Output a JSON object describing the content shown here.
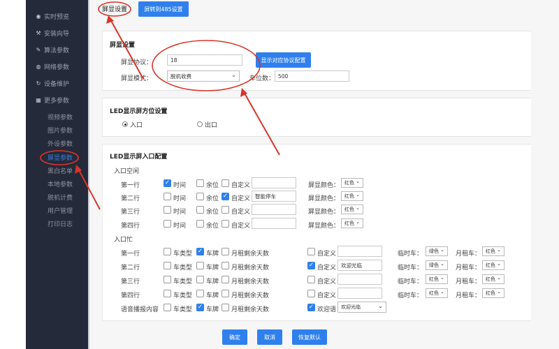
{
  "sidebar": {
    "items": [
      {
        "icon": "eye-icon",
        "glyph": "◉",
        "label": "实时预览"
      },
      {
        "icon": "wrench-icon",
        "glyph": "🔧",
        "label": "安装向导"
      },
      {
        "icon": "pencil-icon",
        "glyph": "✎",
        "label": "算法参数"
      },
      {
        "icon": "globe-icon",
        "glyph": "◍",
        "label": "网络参数"
      },
      {
        "icon": "refresh-icon",
        "glyph": "↻",
        "label": "设备维护"
      },
      {
        "icon": "grid-icon",
        "glyph": "▦",
        "label": "更多参数"
      }
    ],
    "sub_items": [
      {
        "label": "视频参数",
        "active": false
      },
      {
        "label": "图片参数",
        "active": false
      },
      {
        "label": "外设参数",
        "active": false
      },
      {
        "label": "屏显参数",
        "active": true
      },
      {
        "label": "黑白名单",
        "active": false
      },
      {
        "label": "本地参数",
        "active": false
      },
      {
        "label": "脱机计费",
        "active": false
      },
      {
        "label": "用户管理",
        "active": false
      },
      {
        "label": "打印日志",
        "active": false
      }
    ]
  },
  "tabs": {
    "active": "屏显设置",
    "other": "屏转到485设置"
  },
  "screen_settings": {
    "title": "屏显设置",
    "protocol_label": "屏显协议：",
    "protocol_value": "18",
    "show_config_button": "显示对应协议配置",
    "mode_label": "屏显模式：",
    "mode_value": "脱机收费",
    "spaces_label": "车位数：",
    "spaces_value": "500"
  },
  "position_settings": {
    "title": "LED显示屏方位设置",
    "options": [
      {
        "label": "入口",
        "selected": true
      },
      {
        "label": "出口",
        "selected": false
      }
    ]
  },
  "entry_config": {
    "title": "LED显示屏入口配置",
    "idle": {
      "label": "入口空闲",
      "rows": [
        {
          "label": "第一行",
          "time": true,
          "remaining": false,
          "custom": false,
          "custom_text": "",
          "color": "红色"
        },
        {
          "label": "第二行",
          "time": false,
          "remaining": false,
          "custom": true,
          "custom_text": "智能停车",
          "color": "红色"
        },
        {
          "label": "第三行",
          "time": false,
          "remaining": false,
          "custom": false,
          "custom_text": "",
          "color": "红色"
        },
        {
          "label": "第四行",
          "time": false,
          "remaining": false,
          "custom": false,
          "custom_text": "",
          "color": "红色"
        }
      ],
      "time_label": "时间",
      "remaining_label": "余位",
      "custom_label": "自定义",
      "color_label": "屏显颜色："
    },
    "busy": {
      "label": "入口忙",
      "rows": [
        {
          "label": "第一行",
          "car_type": false,
          "plate": true,
          "monthly_days": false,
          "custom": false,
          "custom_text": "",
          "temp_color": "绿色",
          "monthly_color": "红色"
        },
        {
          "label": "第二行",
          "car_type": false,
          "plate": false,
          "monthly_days": false,
          "custom": true,
          "custom_text": "欢迎光临",
          "temp_color": "绿色",
          "monthly_color": "红色"
        },
        {
          "label": "第三行",
          "car_type": false,
          "plate": false,
          "monthly_days": false,
          "custom": false,
          "custom_text": "",
          "temp_color": "红色",
          "monthly_color": "红色"
        },
        {
          "label": "第四行",
          "car_type": false,
          "plate": false,
          "monthly_days": false,
          "custom": false,
          "custom_text": "",
          "temp_color": "红色",
          "monthly_color": "红色"
        }
      ],
      "voice_row": {
        "label": "语音播报内容",
        "car_type": false,
        "plate": true,
        "monthly_days": false,
        "welcome": true,
        "welcome_label": "欢迎语",
        "welcome_value": "欢迎光临"
      },
      "car_type_label": "车类型",
      "plate_label": "车牌",
      "monthly_days_label": "月租剩余天数",
      "custom_label": "自定义",
      "temp_car_label": "临时车：",
      "monthly_car_label": "月租车："
    }
  },
  "footer": {
    "confirm": "确定",
    "cancel": "取消",
    "restore_default": "恢复默认"
  },
  "colors": {
    "accent": "#2f80ed",
    "sidebar_bg": "#252a3a",
    "annotation": "#d9342b"
  }
}
